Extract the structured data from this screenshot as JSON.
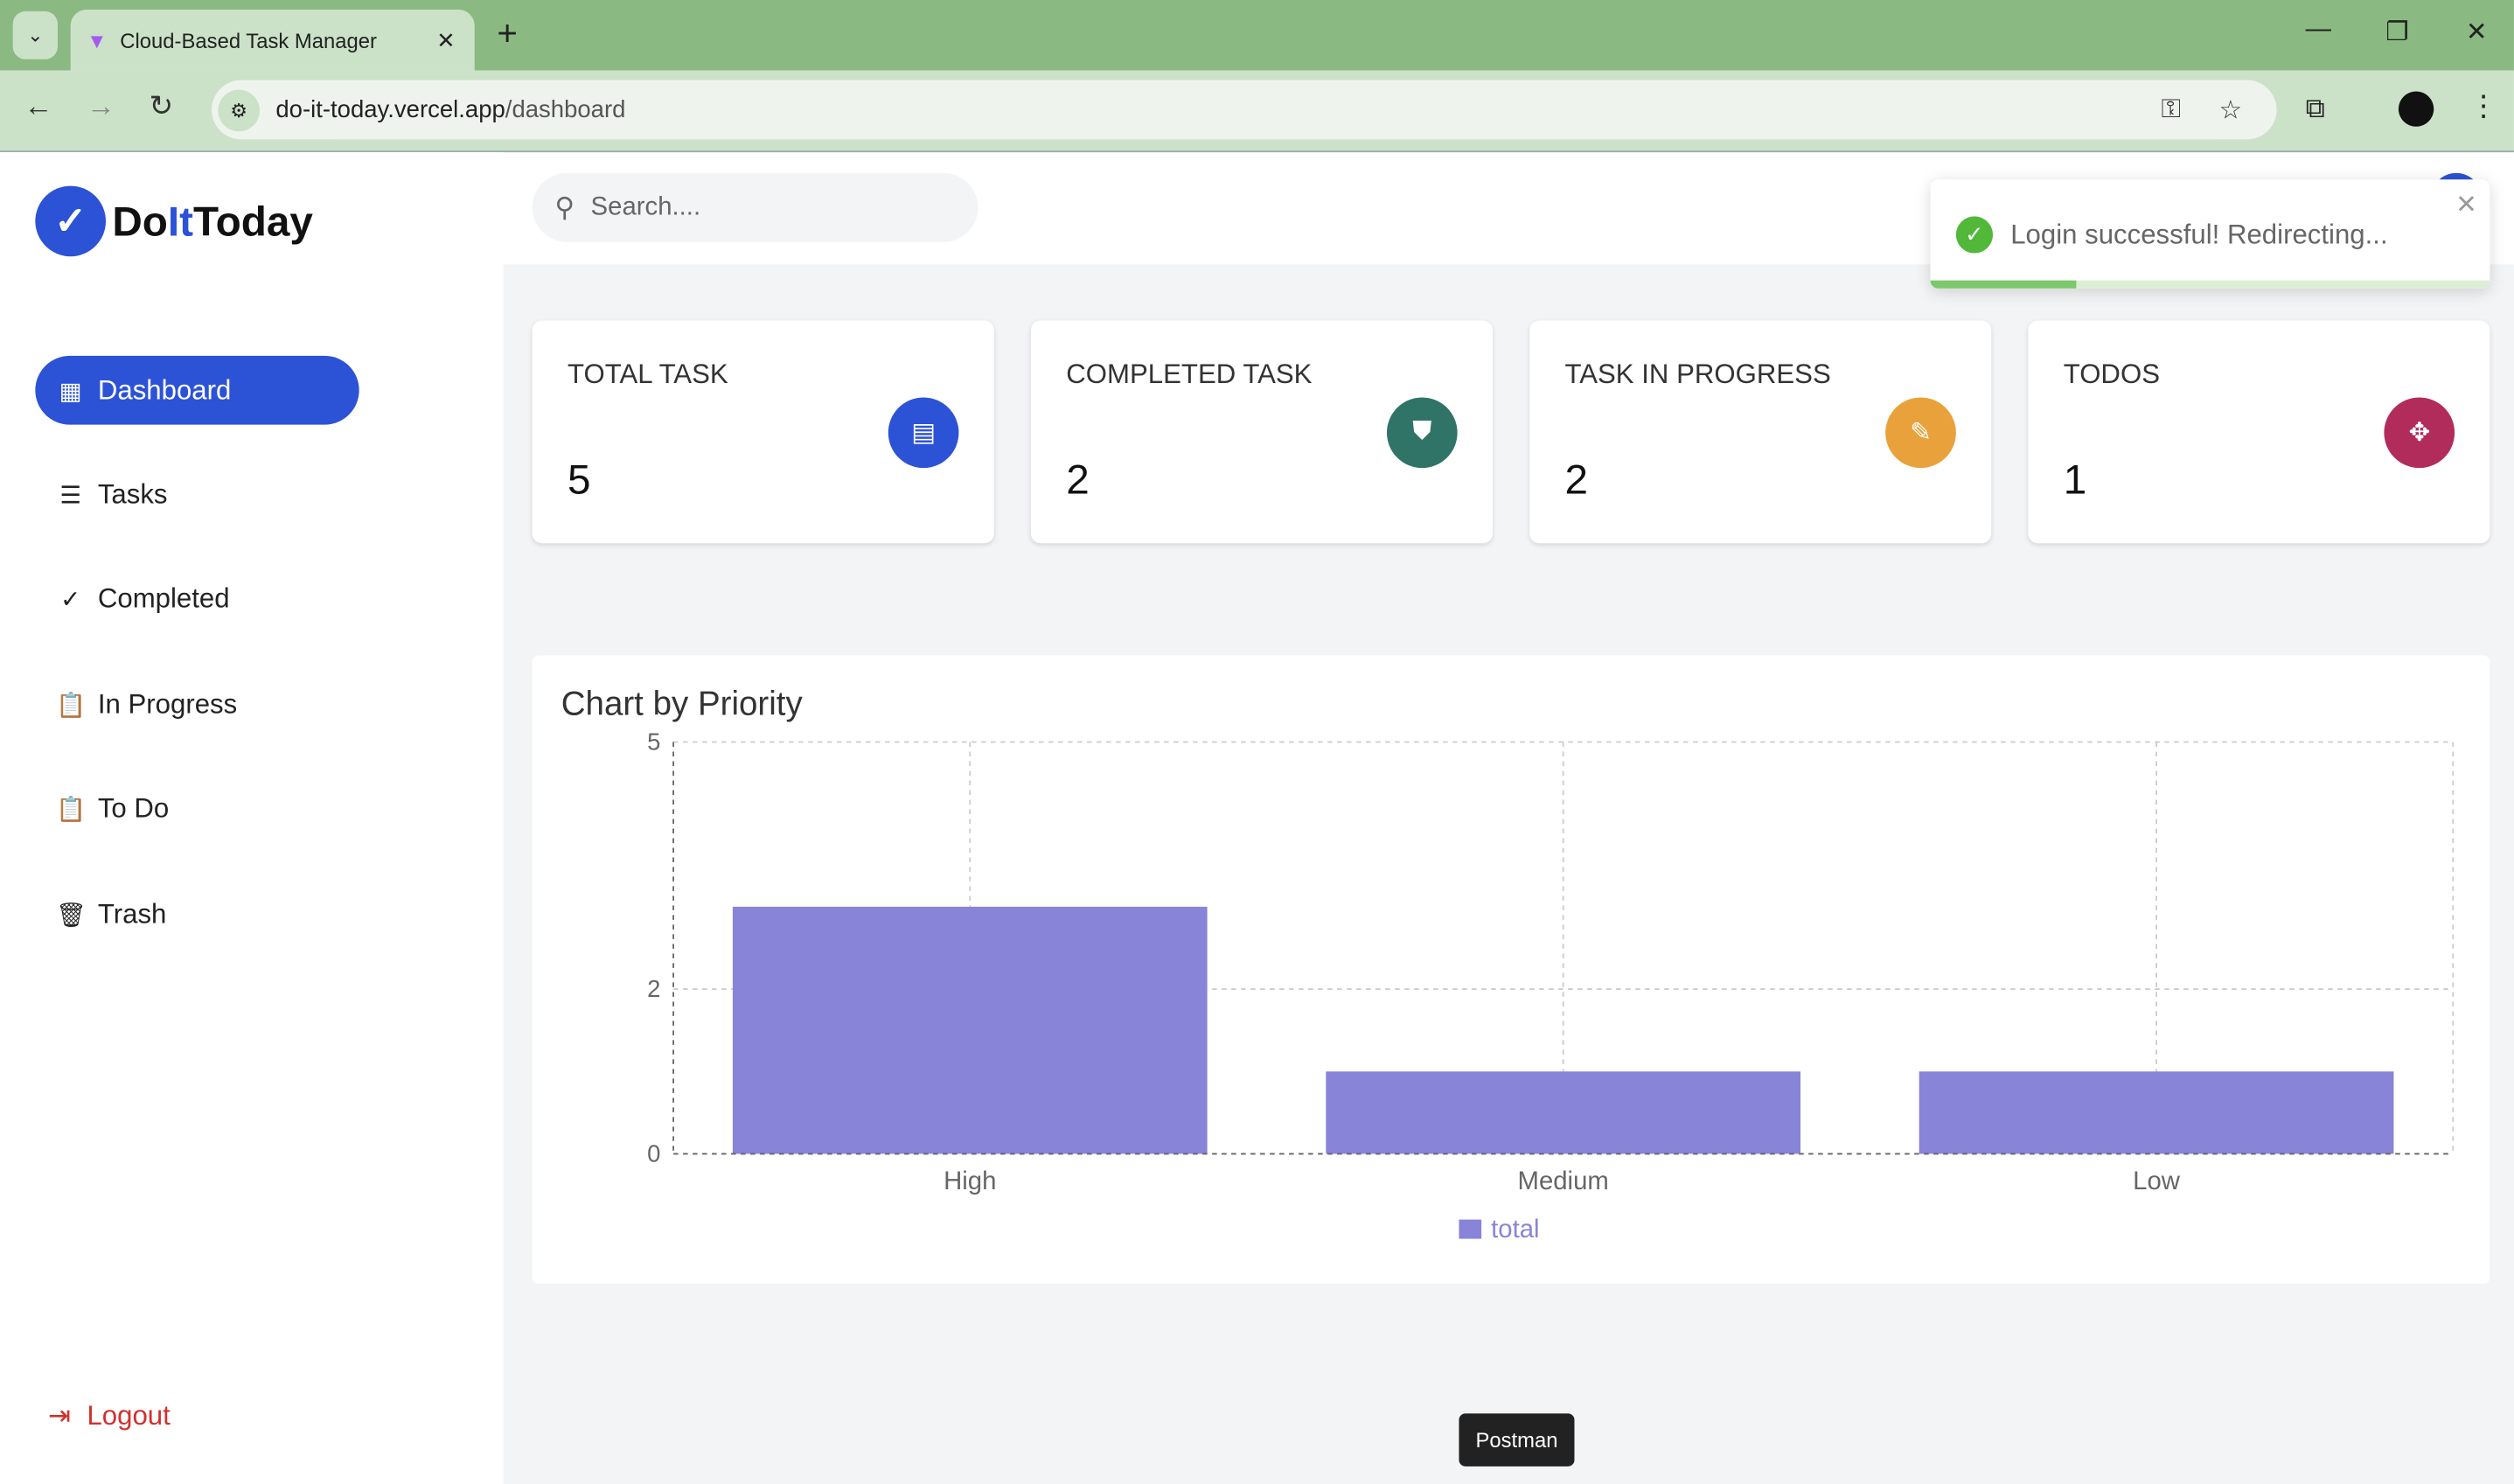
{
  "browser": {
    "tab_title": "Cloud-Based Task Manager",
    "url_domain": "do-it-today.vercel.app",
    "url_path": "/dashboard"
  },
  "app": {
    "logo_prefix": "Do",
    "logo_mid": "It",
    "logo_suffix": "Today",
    "search_placeholder": "Search...."
  },
  "sidebar": {
    "items": [
      {
        "label": "Dashboard",
        "icon": "grid-icon"
      },
      {
        "label": "Tasks",
        "icon": "list-icon"
      },
      {
        "label": "Completed",
        "icon": "check-circle-icon"
      },
      {
        "label": "In Progress",
        "icon": "clipboard-icon"
      },
      {
        "label": "To Do",
        "icon": "clipboard-icon"
      },
      {
        "label": "Trash",
        "icon": "trash-icon"
      }
    ],
    "logout": "Logout"
  },
  "stats": [
    {
      "label": "TOTAL TASK",
      "value": "5",
      "color": "#2c52d6",
      "icon": "list-alt-icon"
    },
    {
      "label": "COMPLETED TASK",
      "value": "2",
      "color": "#2f7467",
      "icon": "shield-check-icon"
    },
    {
      "label": "TASK IN PROGRESS",
      "value": "2",
      "color": "#e9a23b",
      "icon": "clipboard-edit-icon"
    },
    {
      "label": "TODOS",
      "value": "1",
      "color": "#b12c5b",
      "icon": "arrows-collapse-icon"
    }
  ],
  "chart_data": {
    "type": "bar",
    "title": "Chart by Priority",
    "categories": [
      "High",
      "Medium",
      "Low"
    ],
    "series": [
      {
        "name": "total",
        "values": [
          3,
          1,
          1
        ],
        "color": "#8884d8"
      }
    ],
    "yticks": [
      0,
      2,
      5
    ],
    "ylim": [
      0,
      5
    ],
    "grid": true,
    "legend": "bottom"
  },
  "toast": {
    "message": "Login successful! Redirecting...",
    "progress": 0.26
  },
  "tooltip": "Postman"
}
